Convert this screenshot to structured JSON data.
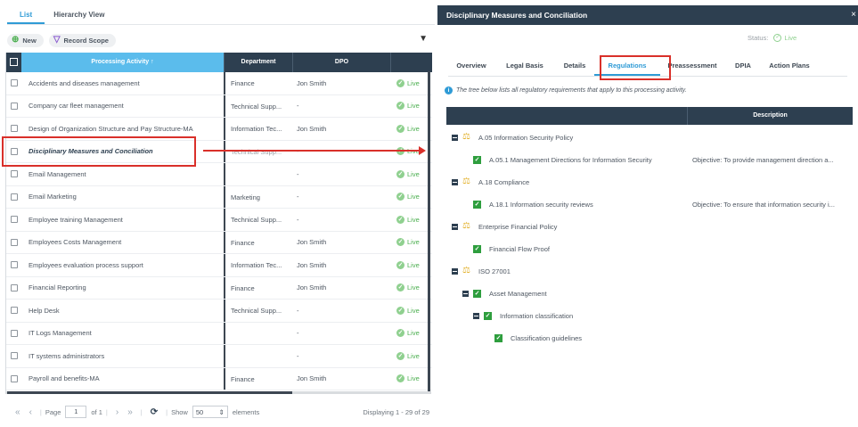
{
  "left": {
    "view_tabs": [
      "List",
      "Hierarchy View"
    ],
    "toolbar": {
      "new_label": "New",
      "record_scope_label": "Record Scope"
    },
    "columns": {
      "activity": "Processing Activity",
      "activity_sort": "↑",
      "department": "Department",
      "dpo": "DPO"
    },
    "rows": [
      {
        "activity": "Accidents and diseases management",
        "department": "Finance",
        "dpo": "Jon Smith",
        "status": "Live"
      },
      {
        "activity": "Company car fleet management",
        "department": "Technical Supp...",
        "dpo": "-",
        "status": "Live"
      },
      {
        "activity": "Design of Organization Structure and Pay Structure-MA",
        "department": "Information Tec...",
        "dpo": "Jon Smith",
        "status": "Live"
      },
      {
        "activity": "Disciplinary Measures and Conciliation",
        "department": "Technical Supp...",
        "dpo": "-",
        "status": "Live"
      },
      {
        "activity": "Email Management",
        "department": "",
        "dpo": "-",
        "status": "Live"
      },
      {
        "activity": "Email Marketing",
        "department": "Marketing",
        "dpo": "-",
        "status": "Live"
      },
      {
        "activity": "Employee training Management",
        "department": "Technical Supp...",
        "dpo": "-",
        "status": "Live"
      },
      {
        "activity": "Employees Costs Management",
        "department": "Finance",
        "dpo": "Jon Smith",
        "status": "Live"
      },
      {
        "activity": "Employees evaluation process support",
        "department": "Information Tec...",
        "dpo": "Jon Smith",
        "status": "Live"
      },
      {
        "activity": "Financial Reporting",
        "department": "Finance",
        "dpo": "Jon Smith",
        "status": "Live"
      },
      {
        "activity": "Help Desk",
        "department": "Technical Supp...",
        "dpo": "-",
        "status": "Live"
      },
      {
        "activity": "IT Logs Management",
        "department": "",
        "dpo": "-",
        "status": "Live"
      },
      {
        "activity": "IT systems administrators",
        "department": "",
        "dpo": "-",
        "status": "Live"
      },
      {
        "activity": "Payroll and benefits-MA",
        "department": "Finance",
        "dpo": "Jon Smith",
        "status": "Live"
      }
    ],
    "pager": {
      "page_label": "Page",
      "page_value": "1",
      "of_label": "of 1",
      "show_label": "Show",
      "page_size": "50",
      "elements_label": "elements",
      "displaying": "Displaying 1 - 29 of 29"
    }
  },
  "right": {
    "title": "Disciplinary Measures and Conciliation",
    "close": "×",
    "status_label": "Status:",
    "status_value": "Live",
    "tabs": [
      "Overview",
      "Legal Basis",
      "Details",
      "Regulations",
      "Preassessment",
      "DPIA",
      "Action Plans"
    ],
    "info": "The tree below lists all regulatory requirements that apply to this processing activity.",
    "description_header": "Description",
    "tree": [
      {
        "label": "A.05 Information Security Policy",
        "description": ""
      },
      {
        "label": "A.05.1 Management Directions for Information Security",
        "description": "Objective: To provide management direction a..."
      },
      {
        "label": "A.18 Compliance",
        "description": ""
      },
      {
        "label": "A.18.1 Information security reviews",
        "description": "Objective: To ensure that information security i..."
      },
      {
        "label": "Enterprise Financial Policy",
        "description": ""
      },
      {
        "label": "Financial Flow Proof",
        "description": ""
      },
      {
        "label": "ISO 27001",
        "description": ""
      },
      {
        "label": "Asset Management",
        "description": ""
      },
      {
        "label": "Information classification",
        "description": ""
      },
      {
        "label": "Classification guidelines",
        "description": ""
      }
    ]
  },
  "colors": {
    "accent": "#2f9bd6",
    "header_dark": "#2d3f50",
    "header_light": "#5bbcec",
    "live": "#4caf50",
    "highlight": "#d9302a"
  }
}
